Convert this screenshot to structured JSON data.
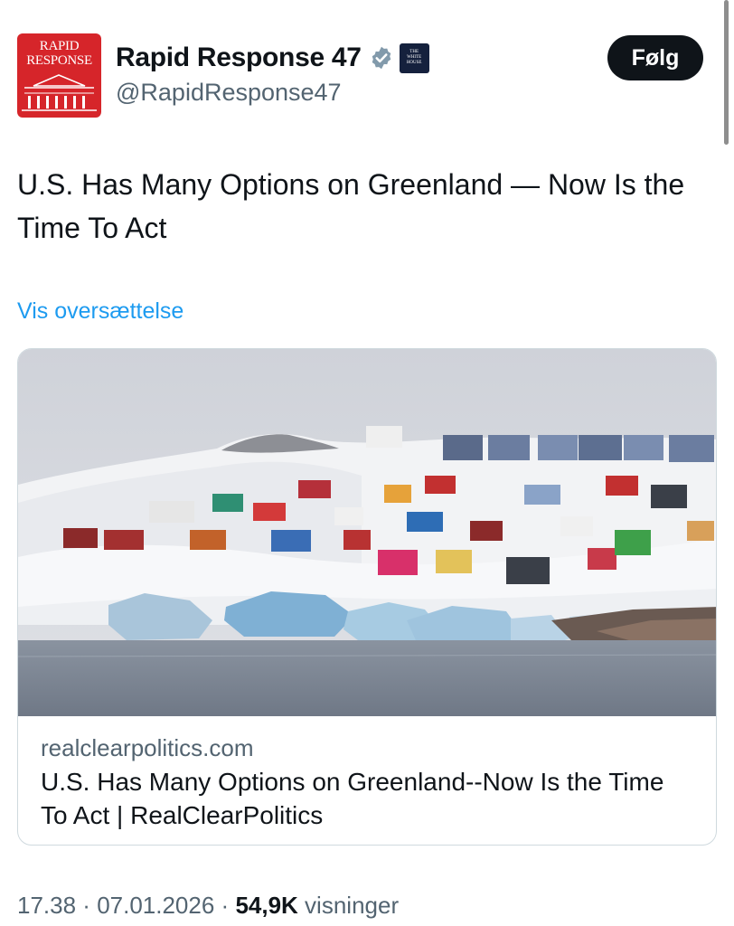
{
  "author": {
    "display_name": "Rapid Response 47",
    "handle": "@RapidResponse47",
    "avatar_text_line1": "RAPID",
    "avatar_text_line2": "RESPONSE",
    "affiliate_badge_text_line1": "THE",
    "affiliate_badge_text_line2": "WHITE",
    "affiliate_badge_text_line3": "HOUSE",
    "verified_icon": "verified-badge-icon"
  },
  "follow_button": {
    "label": "Følg"
  },
  "tweet": {
    "text": "U.S. Has Many Options on Greenland — Now Is the Time To Act",
    "translate_link": "Vis oversættelse"
  },
  "link_card": {
    "domain": "realclearpolitics.com",
    "title": "U.S. Has Many Options on Greenland--Now Is the Time To Act | RealClearPolitics"
  },
  "meta": {
    "time": "17.38",
    "separator1": " · ",
    "date": "07.01.2026",
    "separator2": " · ",
    "views_count": "54,9K",
    "views_label": " visninger"
  },
  "colors": {
    "accent": "#1d9bf0",
    "avatar_bg": "#d6252a",
    "text_primary": "#0f1419",
    "text_secondary": "#536471",
    "follow_bg": "#0f1419"
  }
}
